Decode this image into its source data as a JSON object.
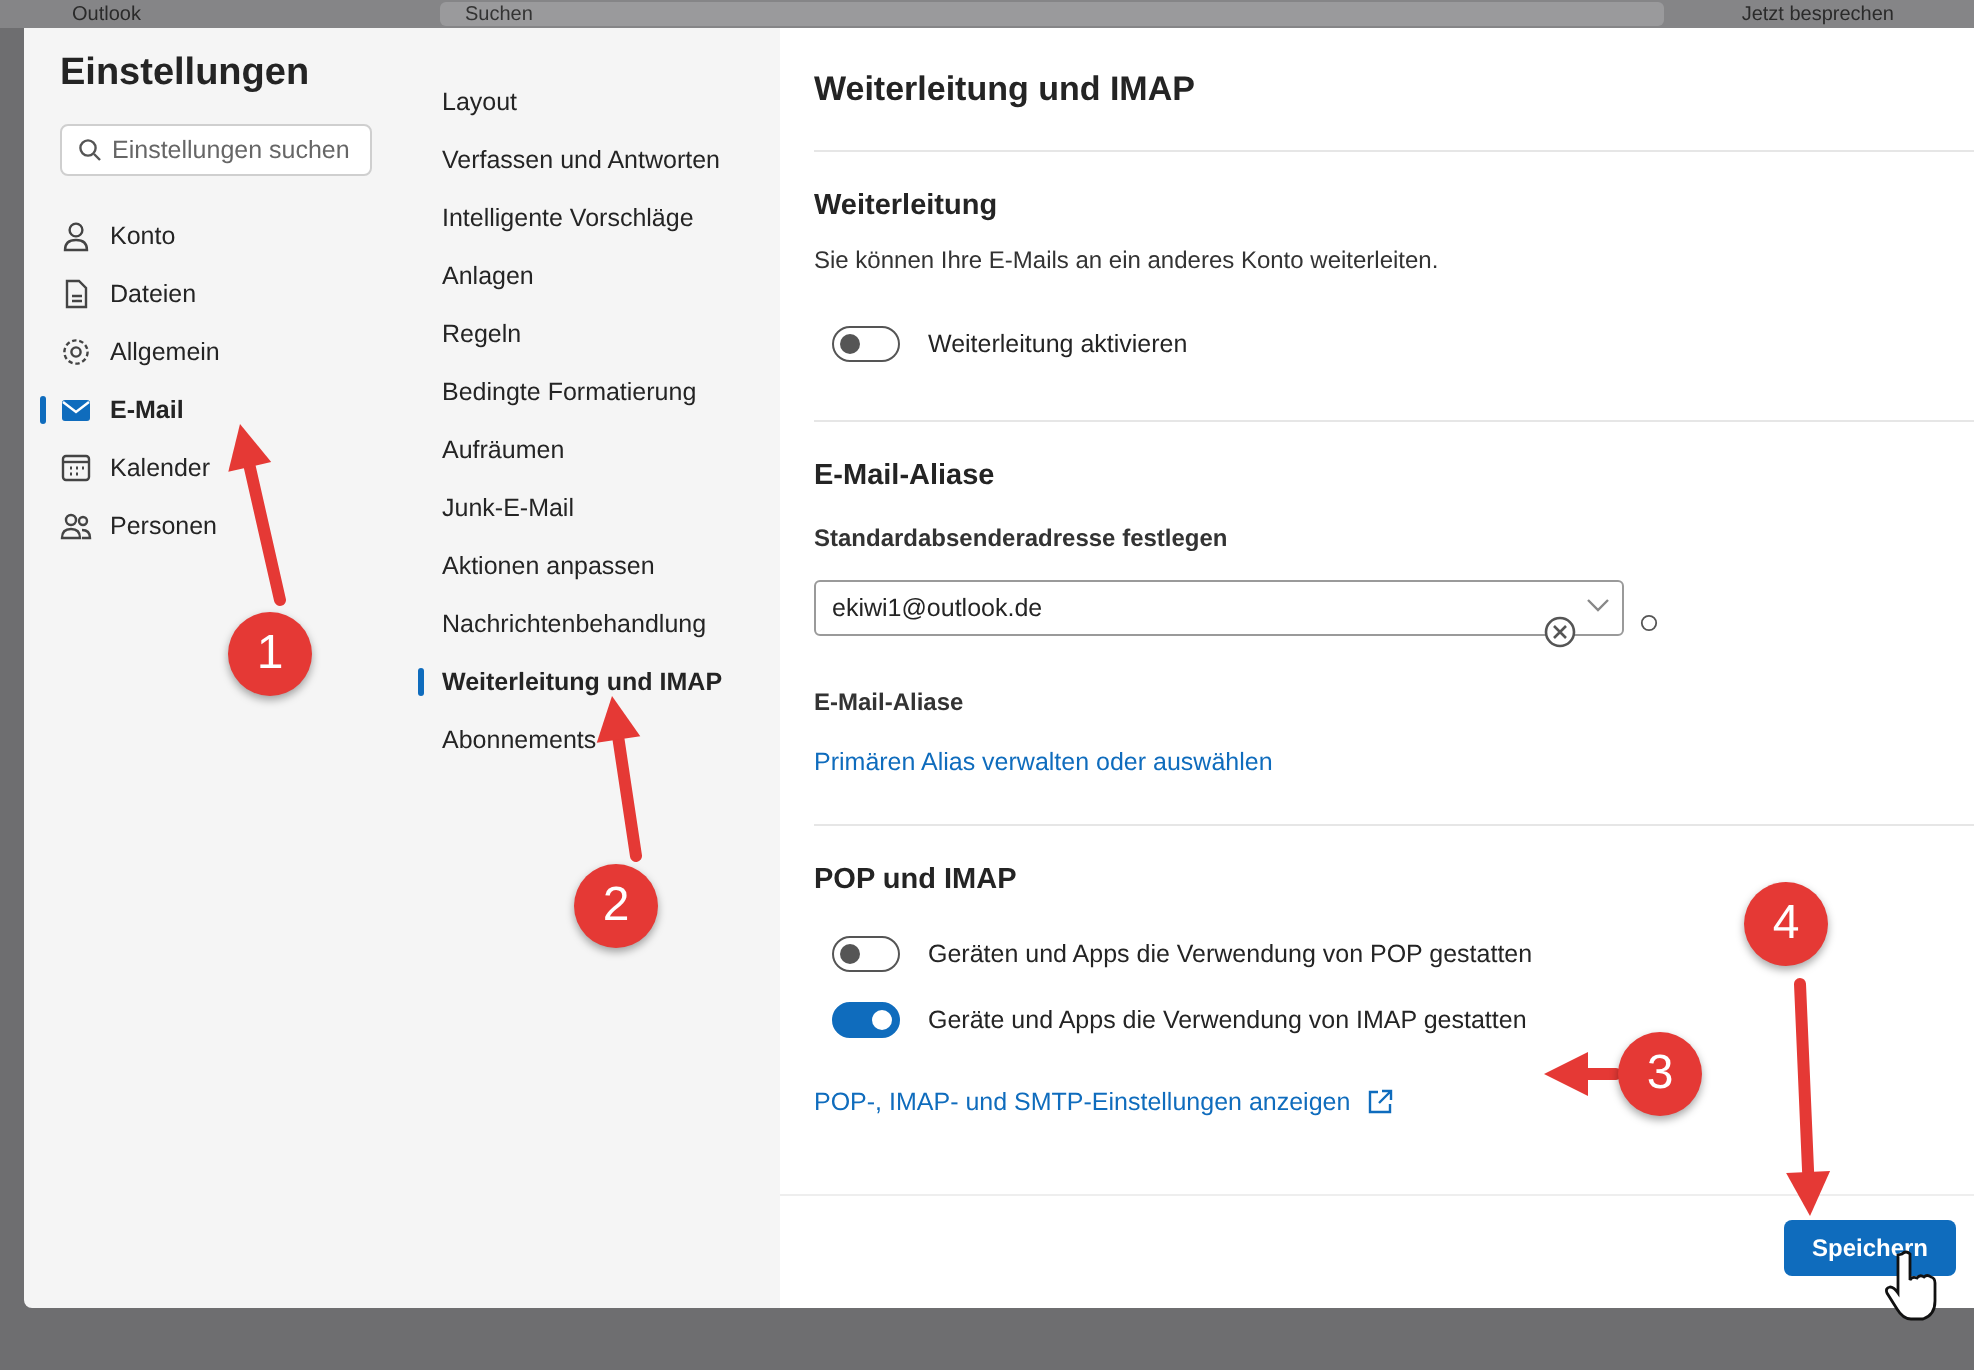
{
  "background_window": {
    "app_title": "Outlook",
    "search_placeholder": "Suchen",
    "top_action": "Jetzt besprechen"
  },
  "settings": {
    "title": "Einstellungen",
    "search": {
      "placeholder": "Einstellungen suchen"
    },
    "categories": [
      {
        "label": "Konto",
        "selected": false
      },
      {
        "label": "Dateien",
        "selected": false
      },
      {
        "label": "Allgemein",
        "selected": false
      },
      {
        "label": "E-Mail",
        "selected": true
      },
      {
        "label": "Kalender",
        "selected": false
      },
      {
        "label": "Personen",
        "selected": false
      }
    ],
    "subcategories": [
      {
        "label": "Layout",
        "selected": false
      },
      {
        "label": "Verfassen und Antworten",
        "selected": false
      },
      {
        "label": "Intelligente Vorschläge",
        "selected": false
      },
      {
        "label": "Anlagen",
        "selected": false
      },
      {
        "label": "Regeln",
        "selected": false
      },
      {
        "label": "Bedingte Formatierung",
        "selected": false
      },
      {
        "label": "Aufräumen",
        "selected": false
      },
      {
        "label": "Junk-E-Mail",
        "selected": false
      },
      {
        "label": "Aktionen anpassen",
        "selected": false
      },
      {
        "label": "Nachrichtenbehandlung",
        "selected": false
      },
      {
        "label": "Weiterleitung und IMAP",
        "selected": true
      },
      {
        "label": "Abonnements",
        "selected": false
      }
    ]
  },
  "content": {
    "title": "Weiterleitung und IMAP",
    "sections": [
      {
        "heading": "Weiterleitung",
        "items": [
          {
            "kind": "description",
            "text": "Sie können Ihre E-Mails an ein anderes Konto weiterleiten."
          },
          {
            "kind": "toggle",
            "label": "Weiterleitung aktivieren",
            "on": false
          }
        ]
      },
      {
        "heading": "E-Mail-Aliase",
        "items": [
          {
            "kind": "field_label",
            "text": "Standardabsenderadresse festlegen"
          },
          {
            "kind": "dropdown",
            "value": "ekiwi1@outlook.de"
          },
          {
            "kind": "field_label",
            "text": "E-Mail-Aliase"
          },
          {
            "kind": "link",
            "text": "Primären Alias verwalten oder auswählen",
            "external": false
          }
        ]
      },
      {
        "heading": "POP und IMAP",
        "items": [
          {
            "kind": "toggle",
            "label": "Geräten und Apps die Verwendung von POP gestatten",
            "on": false
          },
          {
            "kind": "toggle",
            "label": "Geräte und Apps die Verwendung von IMAP gestatten",
            "on": true
          },
          {
            "kind": "link",
            "text": "POP-, IMAP- und SMTP-Einstellungen anzeigen",
            "external": true
          }
        ]
      }
    ]
  },
  "footer": {
    "save_button": "Speichern"
  },
  "annotations": [
    {
      "label": "1"
    },
    {
      "label": "2"
    },
    {
      "label": "3"
    },
    {
      "label": "4"
    }
  ]
}
